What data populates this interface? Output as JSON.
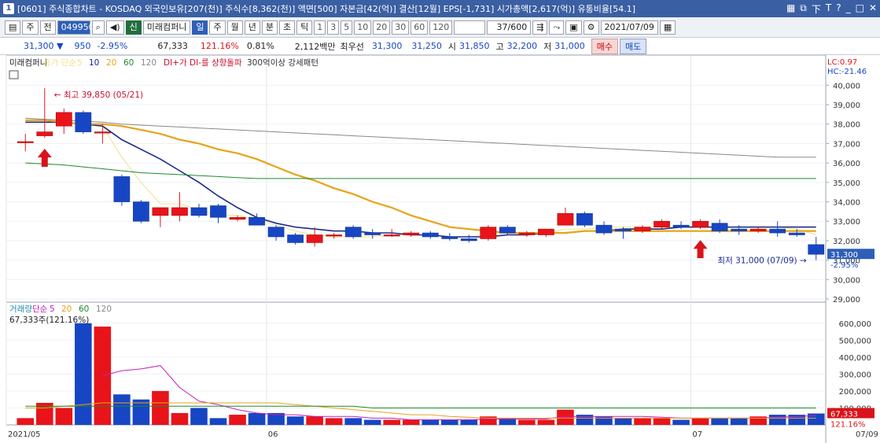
{
  "window": {
    "number": "1",
    "title": "[0601] 주식종합차트 - KOSDAQ 외국인보유[207(천)] 주식수[8,362(천)] 액면[500] 자본금[42(억)] 결산[12월] EPS[-1,731] 시가총액[2,617(억)] 유통비율[54.1]",
    "controls": [
      "▦",
      "⧉",
      "下",
      "T",
      "?",
      "_",
      "□",
      "✕"
    ]
  },
  "toolbar": {
    "market": "주",
    "prev": "전",
    "code": "049950",
    "stock_badge": "신",
    "stock_name": "미래컴퍼니",
    "periods": [
      "일",
      "주",
      "월",
      "년",
      "분",
      "초",
      "틱"
    ],
    "active_period": "일",
    "minutes": [
      "1",
      "3",
      "5",
      "10",
      "20",
      "30",
      "60",
      "120"
    ],
    "count": "37",
    "max_count": "/600",
    "date": "2021/07/09"
  },
  "quote": {
    "price": "31,300 ▼",
    "change": "950",
    "change_pct": "-2.95%",
    "volume": "67,333",
    "volume_ratio": "121.16%",
    "turnover": "0.81%",
    "amount": "2,112백만",
    "pref_label": "최우선",
    "ask": "31,300",
    "bid": "31,250",
    "open_label": "시",
    "open": "31,850",
    "high_label": "고",
    "high": "32,200",
    "low_label": "저",
    "low": "31,000",
    "buy_label": "매수",
    "sell_label": "매도"
  },
  "price_panel": {
    "legend": [
      {
        "text": "미래컴퍼니",
        "color": "#222222"
      },
      {
        "text": "종가 단순",
        "color": "#f2e08a"
      },
      {
        "text": "5",
        "color": "#f2e08a"
      },
      {
        "text": "10",
        "color": "#1a2a8a"
      },
      {
        "text": "20",
        "color": "#e8a317"
      },
      {
        "text": "60",
        "color": "#1d8a2a"
      },
      {
        "text": "120",
        "color": "#888888"
      },
      {
        "text": "DI+가 DI-를 상향돌파",
        "color": "#c8102e"
      },
      {
        "text": "300억이상 강세패턴",
        "color": "#333333"
      }
    ],
    "lc": "LC:0.97",
    "hc": "HC:-21.46",
    "high_annotation": "최고 39,850 (05/21)",
    "low_annotation": "최저 31,000 (07/09)",
    "last_price_tag": "31,300",
    "last_pct_tag": "-2.95%",
    "yticks": [
      40000,
      39000,
      38000,
      37000,
      36000,
      35000,
      34000,
      33000,
      32000,
      31000,
      30000,
      29000
    ],
    "ytick_labels": [
      "40,000",
      "39,000",
      "38,000",
      "37,000",
      "36,000",
      "35,000",
      "34,000",
      "33,000",
      "32,000",
      "31,000",
      "30,000",
      "29,000"
    ]
  },
  "volume_panel": {
    "legend": [
      {
        "text": "거래량",
        "color": "#1a8aa8"
      },
      {
        "text": "단순",
        "color": "#c020c0"
      },
      {
        "text": "5",
        "color": "#c020c0"
      },
      {
        "text": "20",
        "color": "#e8a317"
      },
      {
        "text": "60",
        "color": "#1d8a2a"
      },
      {
        "text": "120",
        "color": "#888888"
      }
    ],
    "current_label": "67,333주(121.16%)",
    "last_volume_tag": "67,333",
    "last_pct_tag": "121.16%",
    "yticks": [
      600000,
      500000,
      400000,
      300000,
      200000,
      100000
    ],
    "ytick_labels": [
      "600,000",
      "500,000",
      "400,000",
      "300,000",
      "200,000",
      "100,000"
    ]
  },
  "x_axis": {
    "labels": [
      "2021/05",
      "06",
      "07"
    ],
    "right_label": "07/09"
  },
  "chart_data": {
    "type": "candlestick",
    "x": [
      "05/12",
      "05/13",
      "05/14",
      "05/17",
      "05/18",
      "05/20",
      "05/21",
      "05/24",
      "05/25",
      "05/26",
      "05/27",
      "05/28",
      "05/31",
      "06/01",
      "06/02",
      "06/03",
      "06/04",
      "06/07",
      "06/08",
      "06/09",
      "06/10",
      "06/11",
      "06/14",
      "06/15",
      "06/16",
      "06/17",
      "06/18",
      "06/21",
      "06/22",
      "06/23",
      "06/24",
      "06/25",
      "06/28",
      "06/29",
      "06/30",
      "07/01",
      "07/02",
      "07/05",
      "07/06",
      "07/07",
      "07/08",
      "07/09"
    ],
    "candles": [
      {
        "o": 37100,
        "h": 37500,
        "l": 36600,
        "c": 37100,
        "v": 40000
      },
      {
        "o": 37400,
        "h": 39850,
        "l": 37300,
        "c": 37600,
        "v": 130000
      },
      {
        "o": 37900,
        "h": 38800,
        "l": 37500,
        "c": 38600,
        "v": 100000
      },
      {
        "o": 38600,
        "h": 38700,
        "l": 37500,
        "c": 37600,
        "v": 600000
      },
      {
        "o": 37600,
        "h": 38000,
        "l": 37000,
        "c": 37600,
        "v": 580000
      },
      {
        "o": 35300,
        "h": 35400,
        "l": 33800,
        "c": 34000,
        "v": 180000
      },
      {
        "o": 34000,
        "h": 34100,
        "l": 32900,
        "c": 33000,
        "v": 150000
      },
      {
        "o": 33300,
        "h": 33500,
        "l": 32700,
        "c": 33700,
        "v": 200000
      },
      {
        "o": 33300,
        "h": 34500,
        "l": 33000,
        "c": 33700,
        "v": 70000
      },
      {
        "o": 33700,
        "h": 33900,
        "l": 33200,
        "c": 33300,
        "v": 100000
      },
      {
        "o": 33800,
        "h": 33900,
        "l": 32900,
        "c": 33200,
        "v": 40000
      },
      {
        "o": 33100,
        "h": 33300,
        "l": 33000,
        "c": 33200,
        "v": 60000
      },
      {
        "o": 33200,
        "h": 33400,
        "l": 32800,
        "c": 32800,
        "v": 70000
      },
      {
        "o": 32700,
        "h": 32800,
        "l": 32000,
        "c": 32200,
        "v": 70000
      },
      {
        "o": 32300,
        "h": 32400,
        "l": 31800,
        "c": 31900,
        "v": 50000
      },
      {
        "o": 31900,
        "h": 32700,
        "l": 31700,
        "c": 32300,
        "v": 50000
      },
      {
        "o": 32300,
        "h": 32400,
        "l": 32100,
        "c": 32300,
        "v": 40000
      },
      {
        "o": 32700,
        "h": 32800,
        "l": 32100,
        "c": 32200,
        "v": 40000
      },
      {
        "o": 32400,
        "h": 32600,
        "l": 32100,
        "c": 32300,
        "v": 30000
      },
      {
        "o": 32300,
        "h": 32600,
        "l": 32200,
        "c": 32300,
        "v": 30000
      },
      {
        "o": 32300,
        "h": 32500,
        "l": 32200,
        "c": 32400,
        "v": 30000
      },
      {
        "o": 32400,
        "h": 32500,
        "l": 32100,
        "c": 32200,
        "v": 30000
      },
      {
        "o": 32200,
        "h": 32400,
        "l": 32000,
        "c": 32100,
        "v": 30000
      },
      {
        "o": 32100,
        "h": 32300,
        "l": 31900,
        "c": 32000,
        "v": 30000
      },
      {
        "o": 32100,
        "h": 32800,
        "l": 32000,
        "c": 32700,
        "v": 50000
      },
      {
        "o": 32700,
        "h": 32800,
        "l": 32300,
        "c": 32400,
        "v": 40000
      },
      {
        "o": 32300,
        "h": 32500,
        "l": 32200,
        "c": 32400,
        "v": 30000
      },
      {
        "o": 32300,
        "h": 32600,
        "l": 32200,
        "c": 32600,
        "v": 30000
      },
      {
        "o": 32800,
        "h": 33700,
        "l": 32800,
        "c": 33400,
        "v": 90000
      },
      {
        "o": 33400,
        "h": 33500,
        "l": 32700,
        "c": 32800,
        "v": 60000
      },
      {
        "o": 32800,
        "h": 33000,
        "l": 32300,
        "c": 32400,
        "v": 50000
      },
      {
        "o": 32600,
        "h": 32700,
        "l": 32100,
        "c": 32500,
        "v": 40000
      },
      {
        "o": 32500,
        "h": 32800,
        "l": 32400,
        "c": 32700,
        "v": 40000
      },
      {
        "o": 32700,
        "h": 33100,
        "l": 32600,
        "c": 33000,
        "v": 40000
      },
      {
        "o": 32800,
        "h": 33000,
        "l": 32600,
        "c": 32700,
        "v": 30000
      },
      {
        "o": 32700,
        "h": 33100,
        "l": 32600,
        "c": 33000,
        "v": 40000
      },
      {
        "o": 32900,
        "h": 33100,
        "l": 32400,
        "c": 32500,
        "v": 40000
      },
      {
        "o": 32600,
        "h": 32800,
        "l": 32300,
        "c": 32500,
        "v": 40000
      },
      {
        "o": 32500,
        "h": 32700,
        "l": 32400,
        "c": 32600,
        "v": 50000
      },
      {
        "o": 32600,
        "h": 33000,
        "l": 32200,
        "c": 32400,
        "v": 60000
      },
      {
        "o": 32400,
        "h": 32600,
        "l": 32200,
        "c": 32300,
        "v": 60000
      },
      {
        "o": 31800,
        "h": 32200,
        "l": 31000,
        "c": 31300,
        "v": 67333
      }
    ],
    "ma": [
      {
        "name": "5",
        "color": "#f2e08a",
        "values": [
          null,
          null,
          null,
          null,
          37900,
          36300,
          35000,
          33900,
          33900,
          33600,
          33300,
          33300,
          33100,
          32800,
          32500,
          32300,
          32200,
          32200,
          32200,
          32300,
          32300,
          32300,
          32200,
          32200,
          32300,
          32400,
          32400,
          32400,
          32600,
          32600,
          32700,
          32700,
          32700,
          32700,
          32700,
          32700,
          32700,
          32700,
          32700,
          32700,
          32600,
          32300
        ]
      },
      {
        "name": "10",
        "color": "#1a2a8a",
        "values": [
          38100,
          38100,
          38100,
          38000,
          37900,
          37200,
          36700,
          36200,
          35600,
          35000,
          34300,
          33700,
          33200,
          32900,
          32700,
          32600,
          32500,
          32500,
          32400,
          32400,
          32300,
          32300,
          32200,
          32200,
          32200,
          32300,
          32300,
          32400,
          32400,
          32500,
          32500,
          32600,
          32600,
          32600,
          32700,
          32700,
          32700,
          32700,
          32700,
          32700,
          32700,
          32700
        ]
      },
      {
        "name": "20",
        "color": "#e8a317",
        "values": [
          38200,
          38200,
          38100,
          38000,
          38000,
          37900,
          37700,
          37500,
          37200,
          37000,
          36700,
          36500,
          36200,
          35800,
          35400,
          35100,
          34700,
          34400,
          34000,
          33700,
          33300,
          33000,
          32700,
          32600,
          32500,
          32400,
          32400,
          32400,
          32400,
          32500,
          32500,
          32500,
          32500,
          32500,
          32500,
          32500,
          32500,
          32500,
          32500,
          32500,
          32500,
          32500
        ]
      },
      {
        "name": "60",
        "color": "#1d8a2a",
        "values": [
          36000,
          35950,
          35900,
          35800,
          35700,
          35600,
          35500,
          35450,
          35400,
          35350,
          35300,
          35250,
          35200,
          35200,
          35200,
          35200,
          35200,
          35200,
          35200,
          35200,
          35200,
          35200,
          35200,
          35200,
          35200,
          35200,
          35200,
          35200,
          35200,
          35200,
          35200,
          35200,
          35200,
          35200,
          35200,
          35200,
          35200,
          35200,
          35200,
          35200,
          35200,
          35200
        ]
      },
      {
        "name": "120",
        "color": "#888888",
        "values": [
          38300,
          38250,
          38200,
          38150,
          38100,
          38000,
          37950,
          37900,
          37850,
          37800,
          37750,
          37700,
          37650,
          37600,
          37550,
          37500,
          37450,
          37400,
          37350,
          37300,
          37250,
          37200,
          37150,
          37100,
          37050,
          37000,
          36950,
          36900,
          36850,
          36800,
          36750,
          36700,
          36650,
          36600,
          36550,
          36500,
          36450,
          36400,
          36350,
          36300,
          36300,
          36300
        ]
      }
    ],
    "volume_ma": [
      {
        "name": "5",
        "color": "#c020c0",
        "values": [
          null,
          null,
          null,
          null,
          290000,
          320000,
          330000,
          350000,
          220000,
          140000,
          120000,
          90000,
          70000,
          60000,
          60000,
          50000,
          50000,
          50000,
          40000,
          40000,
          30000,
          30000,
          30000,
          30000,
          35000,
          35000,
          35000,
          35000,
          50000,
          50000,
          50000,
          50000,
          50000,
          45000,
          40000,
          40000,
          40000,
          40000,
          40000,
          45000,
          50000,
          55000
        ]
      },
      {
        "name": "20",
        "color": "#e8a317",
        "values": [
          100000,
          100000,
          110000,
          120000,
          130000,
          130000,
          130000,
          130000,
          130000,
          130000,
          130000,
          130000,
          130000,
          130000,
          120000,
          110000,
          100000,
          90000,
          80000,
          70000,
          60000,
          60000,
          50000,
          45000,
          40000,
          40000,
          40000,
          40000,
          40000,
          40000,
          40000,
          40000,
          40000,
          40000,
          40000,
          40000,
          40000,
          40000,
          40000,
          40000,
          40000,
          40000
        ]
      },
      {
        "name": "60",
        "color": "#1d8a2a",
        "values": [
          110000,
          110000,
          110000,
          110000,
          110000,
          110000,
          110000,
          110000,
          110000,
          110000,
          110000,
          110000,
          110000,
          110000,
          110000,
          110000,
          110000,
          110000,
          100000,
          100000,
          100000,
          100000,
          100000,
          100000,
          100000,
          100000,
          100000,
          100000,
          100000,
          100000,
          100000,
          100000,
          100000,
          100000,
          100000,
          100000,
          100000,
          100000,
          100000,
          100000,
          100000,
          100000
        ]
      }
    ],
    "signals": [
      {
        "date": "05/13",
        "type": "buy"
      },
      {
        "date": "07/01",
        "type": "buy"
      }
    ],
    "ylim": [
      29000,
      40500
    ],
    "vol_ylim": [
      0,
      650000
    ],
    "up_color": "#e8141a",
    "down_color": "#1746c4"
  }
}
